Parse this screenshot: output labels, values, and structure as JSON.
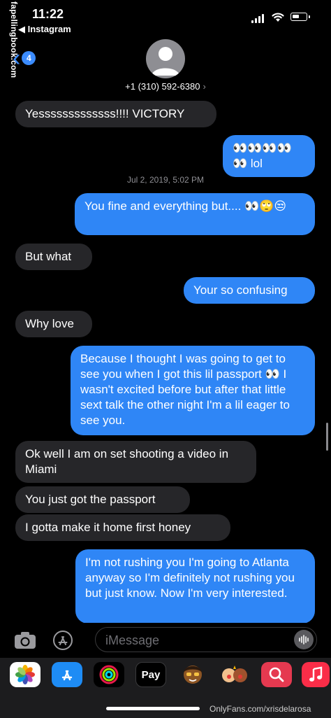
{
  "status_bar": {
    "time": "11:22",
    "back_app": "Instagram",
    "battery_level": 0.55
  },
  "watermark": "fapellingbook.com",
  "header": {
    "back_badge_count": "4",
    "contact": "+1 (310) 592-6380",
    "contact_chevron": "›"
  },
  "messages": [
    {
      "dir": "in",
      "text": "Yesssssssssssss!!!! VICTORY"
    },
    {
      "dir": "out",
      "text": "👀👀👀👀👀 lol"
    },
    {
      "dir": "timestamp",
      "text": "Jul 2, 2019, 5:02 PM"
    },
    {
      "dir": "out",
      "text": "You fine and everything but.... 👀🙄😒"
    },
    {
      "dir": "in",
      "text": "But what"
    },
    {
      "dir": "out",
      "text": "Your so confusing"
    },
    {
      "dir": "in",
      "text": "Why love"
    },
    {
      "dir": "out",
      "text": "Because I thought I was going to get to see you when I got this lil passport 👀 I wasn't excited before but after that little sext talk the other night I'm a lil eager to see you."
    },
    {
      "dir": "in",
      "text": "Ok well I am on set shooting a video in Miami"
    },
    {
      "dir": "in",
      "text": "You just got the passport"
    },
    {
      "dir": "in",
      "text": "I gotta make it home first honey"
    },
    {
      "dir": "out",
      "text": "I'm not rushing you I'm going to Atlanta anyway so I'm definitely not rushing you but just know. Now I'm very interested."
    }
  ],
  "composer": {
    "placeholder": "iMessage"
  },
  "drawer": {
    "apps": [
      "photos-icon",
      "appstore-icon",
      "activity-icon",
      "applepay",
      "memoji-icon",
      "memoji-stickers-icon",
      "search-images-icon",
      "music-icon"
    ],
    "applepay_label": "Pay",
    "applepay_logo": ""
  },
  "onlyfans_watermark": "OnlyFans.com/xrisdelarosa",
  "colors": {
    "outgoing": "#2f86f6",
    "incoming": "#262629",
    "accent": "#3b8cff"
  }
}
